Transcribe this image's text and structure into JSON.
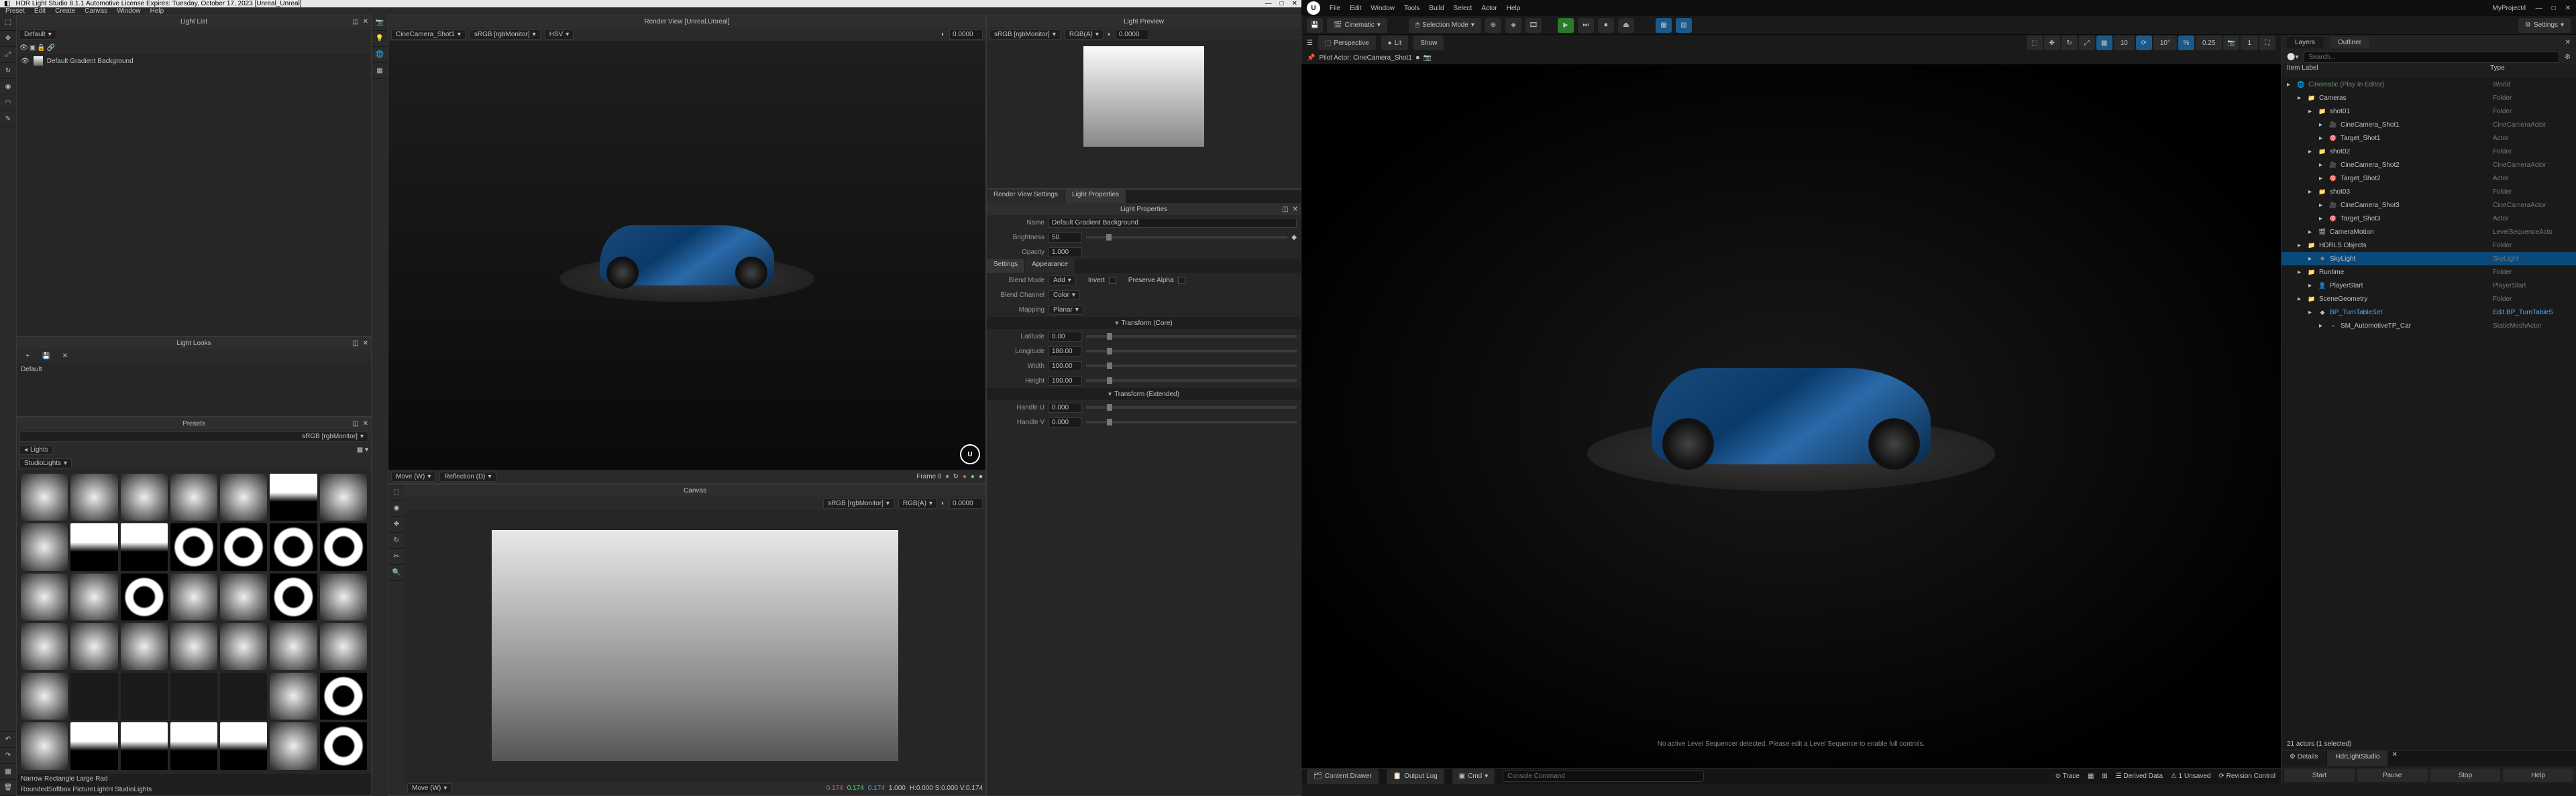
{
  "hdr": {
    "title": "HDR Light Studio 8.1.1   Automotive License Expires: Tuesday, October 17, 2023   [Unreal_Unreal]",
    "menu": [
      "Preset",
      "Edit",
      "Create",
      "Canvas",
      "Window",
      "Help"
    ],
    "lightlist": {
      "title": "Light List",
      "default": "Default",
      "bg_item": "Default Gradient Background"
    },
    "renderview": {
      "title": "Render View [Unreal,Unreal]",
      "camera": "CineCamera_Shot1",
      "colorspace": "sRGB [rgbMonitor]",
      "mode": "HSV",
      "value": "0.0000",
      "nav": "Move (W)",
      "refl": "Reflection (D)",
      "frame": "Frame 0"
    },
    "lightpreview": {
      "title": "Light Preview",
      "cs": "sRGB [rgbMonitor]",
      "rgba": "RGB(A)",
      "val": "0.0000"
    },
    "lightprops": {
      "tab_render": "Render View Settings",
      "tab_light": "Light Properties",
      "header": "Light Properties",
      "name_lbl": "Name",
      "name": "Default Gradient Background",
      "bright_lbl": "Brightness",
      "bright": "50",
      "opac_lbl": "Opacity",
      "opac": "1.000",
      "settings": "Settings",
      "appearance": "Appearance",
      "blendmode_lbl": "Blend Mode",
      "blendmode": "Add",
      "invert": "Invert",
      "preservea": "Preserve Alpha",
      "blendch_lbl": "Blend Channel",
      "blendch": "Color",
      "mapping_lbl": "Mapping",
      "mapping": "Planar",
      "trans_core": "Transform (Core)",
      "lat_lbl": "Latitude",
      "lat": "0.00",
      "lon_lbl": "Longitude",
      "lon": "180.00",
      "width_lbl": "Width",
      "width": "100.00",
      "height_lbl": "Height",
      "height": "100.00",
      "trans_ext": "Transform (Extended)",
      "hu_lbl": "Handle U",
      "hu": "0.000",
      "hv_lbl": "Handle V",
      "hv": "0.000"
    },
    "lightlooks": {
      "title": "Light Looks",
      "default": "Default"
    },
    "presets": {
      "title": "Presets",
      "lights": "Lights",
      "cs": "sRGB [rgbMonitor]",
      "studio": "StudioLights",
      "hover": "Narrow Rectangle Large Rad",
      "path": "RoundedSoftbox PictureLightH StudioLights"
    },
    "canvas": {
      "title": "Canvas",
      "cs": "sRGB [rgbMonitor]",
      "rgba": "RGB(A)",
      "val": "0.0000",
      "nav": "Move (W)",
      "status": "H:0.000 S:0.000 V:0.174",
      "rgb_r": "0.174",
      "rgb_g": "0.174",
      "rgb_b": "0.174",
      "a": "1.000"
    }
  },
  "ue": {
    "menu": [
      "File",
      "Edit",
      "Window",
      "Tools",
      "Build",
      "Select",
      "Actor",
      "Help"
    ],
    "project": "MyProject4",
    "toolbar": {
      "cinematic": "Cinematic",
      "selmode": "Selection Mode",
      "settings": "Settings"
    },
    "vpbar": {
      "persp": "Perspective",
      "lit": "Lit",
      "show": "Show",
      "snap_grid": "10",
      "snap_ang": "10°",
      "snap_scale": "0.25",
      "cam_speed": "1"
    },
    "pilot": "Pilot Actor: CineCamera_Shot1",
    "seqnote": "No active Level Sequencer detected. Please edit a Level Sequence to enable full controls.",
    "statusbar": {
      "content": "Content Drawer",
      "output": "Output Log",
      "cmd": "Cmd",
      "cmd_ph": "Console Command",
      "trace": "Trace",
      "derived": "Derived Data",
      "unsaved": "1 Unsaved",
      "revision": "Revision Control"
    },
    "outliner": {
      "tab_layers": "Layers",
      "tab_outliner": "Outliner",
      "search_ph": "Search...",
      "col_item": "Item Label",
      "col_type": "Type",
      "rows": [
        {
          "d": 0,
          "ic": "🌐",
          "lbl": "Cinematic (Play In Editor)",
          "typ": "World",
          "dim": true
        },
        {
          "d": 1,
          "ic": "📁",
          "lbl": "Cameras",
          "typ": "Folder"
        },
        {
          "d": 2,
          "ic": "📁",
          "lbl": "shot01",
          "typ": "Folder"
        },
        {
          "d": 3,
          "ic": "🎥",
          "lbl": "CineCamera_Shot1",
          "typ": "CineCameraActor"
        },
        {
          "d": 3,
          "ic": "🎯",
          "lbl": "Target_Shot1",
          "typ": "Actor"
        },
        {
          "d": 2,
          "ic": "📁",
          "lbl": "shot02",
          "typ": "Folder"
        },
        {
          "d": 3,
          "ic": "🎥",
          "lbl": "CineCamera_Shot2",
          "typ": "CineCameraActor"
        },
        {
          "d": 3,
          "ic": "🎯",
          "lbl": "Target_Shot2",
          "typ": "Actor"
        },
        {
          "d": 2,
          "ic": "📁",
          "lbl": "shot03",
          "typ": "Folder"
        },
        {
          "d": 3,
          "ic": "🎥",
          "lbl": "CineCamera_Shot3",
          "typ": "CineCameraActor"
        },
        {
          "d": 3,
          "ic": "🎯",
          "lbl": "Target_Shot3",
          "typ": "Actor"
        },
        {
          "d": 2,
          "ic": "🎬",
          "lbl": "CameraMotion",
          "typ": "LevelSequenceActo"
        },
        {
          "d": 1,
          "ic": "📁",
          "lbl": "HDRLS Objects",
          "typ": "Folder"
        },
        {
          "d": 2,
          "ic": "☀",
          "lbl": "SkyLight",
          "typ": "SkyLight",
          "sel": true
        },
        {
          "d": 1,
          "ic": "📁",
          "lbl": "Runtime",
          "typ": "Folder"
        },
        {
          "d": 2,
          "ic": "👤",
          "lbl": "PlayerStart",
          "typ": "PlayerStart"
        },
        {
          "d": 1,
          "ic": "📁",
          "lbl": "SceneGeometry",
          "typ": "Folder"
        },
        {
          "d": 2,
          "ic": "◆",
          "lbl": "BP_TurnTableSet",
          "typ": "Edit BP_TurnTableS",
          "blue": true
        },
        {
          "d": 3,
          "ic": "▫",
          "lbl": "SM_AutomotiveTP_Car",
          "typ": "StaticMeshActor"
        }
      ],
      "stat": "21 actors (1 selected)"
    },
    "details": {
      "tab_details": "Details",
      "tab_hls": "HdrLightStudio",
      "start": "Start",
      "pause": "Pause",
      "stop": "Stop",
      "help": "Help"
    }
  }
}
